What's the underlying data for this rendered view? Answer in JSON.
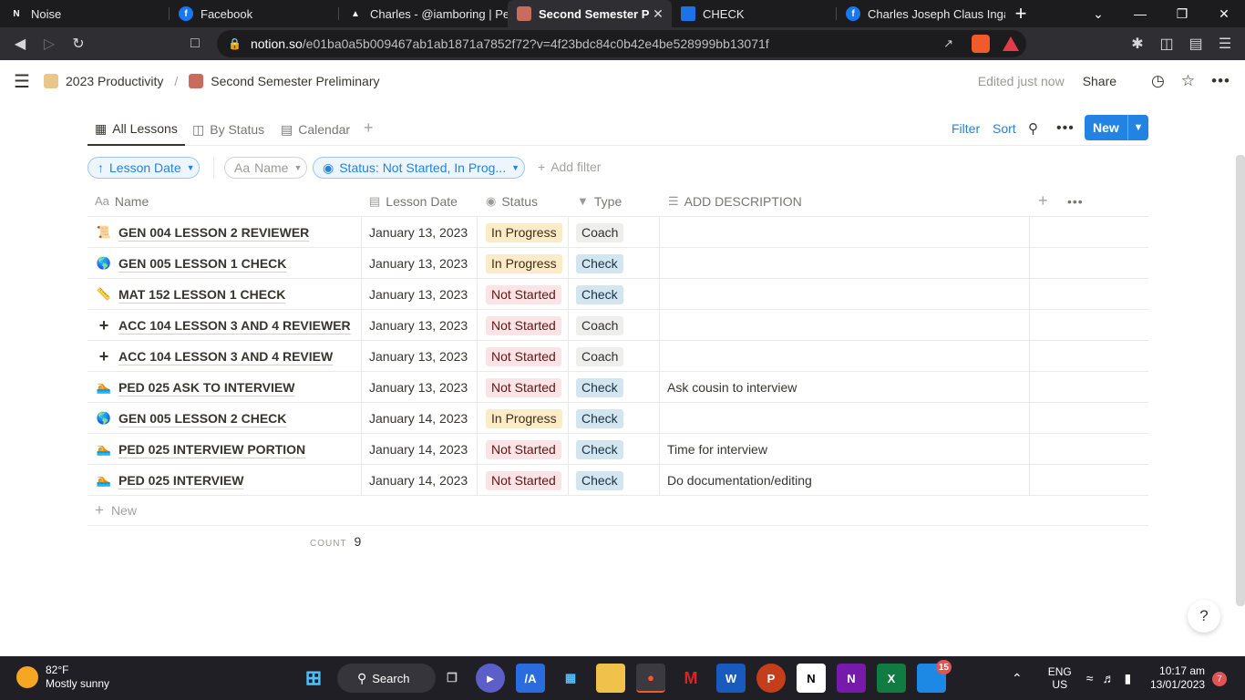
{
  "browser": {
    "tabs": [
      {
        "title": "Noise",
        "icon": "notion-icon",
        "color": "#1c1c1f"
      },
      {
        "title": "Facebook",
        "icon": "facebook-icon",
        "color": "#1877f2"
      },
      {
        "title": "Charles - @iamboring | Pea",
        "icon": "peacock-icon",
        "color": "#ffffff"
      },
      {
        "title": "Second Semester Prelim",
        "icon": "notion-page-icon",
        "color": "#c96c5e",
        "active": true
      },
      {
        "title": "CHECK",
        "icon": "classroom-icon",
        "color": "#1a73e8"
      },
      {
        "title": "Charles Joseph Claus Ingal",
        "icon": "facebook-icon",
        "color": "#1877f2"
      }
    ],
    "url_host": "notion.so",
    "url_path": "/e01ba0a5b009467ab1ab1871a7852f72?v=4f23bdc84c0b42e4be528999bb13071f",
    "brave_shield_count": "6"
  },
  "notion": {
    "breadcrumb": [
      "2023 Productivity",
      "Second Semester Preliminary"
    ],
    "edited": "Edited just now",
    "share": "Share",
    "views": [
      "All Lessons",
      "By Status",
      "Calendar"
    ],
    "toolbar": {
      "filter": "Filter",
      "sort": "Sort",
      "new": "New"
    },
    "chips": {
      "sort": "Lesson Date",
      "name": "Name",
      "status": "Status: Not Started, In Prog..."
    },
    "add_filter": "Add filter",
    "columns": [
      "Name",
      "Lesson Date",
      "Status",
      "Type",
      "ADD DESCRIPTION"
    ],
    "rows": [
      {
        "icon": "scroll-icon",
        "glyph": "📜",
        "name": "GEN 004 LESSON 2 REVIEWER",
        "date": "January 13, 2023",
        "status": "In Progress",
        "type": "Coach",
        "desc": ""
      },
      {
        "icon": "globe-icon",
        "glyph": "🌎",
        "name": "GEN 005 LESSON 1 CHECK",
        "date": "January 13, 2023",
        "status": "In Progress",
        "type": "Check",
        "desc": ""
      },
      {
        "icon": "ruler-icon",
        "glyph": "📏",
        "name": "MAT 152 LESSON 1 CHECK",
        "date": "January 13, 2023",
        "status": "Not Started",
        "type": "Check",
        "desc": ""
      },
      {
        "icon": "plus-icon",
        "glyph": "+",
        "name": "ACC 104 LESSON 3 AND 4 REVIEWER",
        "date": "January 13, 2023",
        "status": "Not Started",
        "type": "Coach",
        "desc": ""
      },
      {
        "icon": "plus-icon",
        "glyph": "+",
        "name": "ACC 104 LESSON 3 AND 4 REVIEW",
        "date": "January 13, 2023",
        "status": "Not Started",
        "type": "Coach",
        "desc": ""
      },
      {
        "icon": "swimmer-icon",
        "glyph": "🏊",
        "name": "PED 025 ASK TO INTERVIEW",
        "date": "January 13, 2023",
        "status": "Not Started",
        "type": "Check",
        "desc": "Ask cousin to interview"
      },
      {
        "icon": "globe-icon",
        "glyph": "🌎",
        "name": "GEN 005 LESSON 2 CHECK",
        "date": "January 14, 2023",
        "status": "In Progress",
        "type": "Check",
        "desc": ""
      },
      {
        "icon": "swimmer-icon",
        "glyph": "🏊",
        "name": "PED 025 INTERVIEW PORTION",
        "date": "January 14, 2023",
        "status": "Not Started",
        "type": "Check",
        "desc": "Time for interview"
      },
      {
        "icon": "swimmer-icon",
        "glyph": "🏊",
        "name": "PED 025 INTERVIEW",
        "date": "January 14, 2023",
        "status": "Not Started",
        "type": "Check",
        "desc": "Do documentation/editing"
      }
    ],
    "new_row": "New",
    "count_label": "COUNT",
    "count_value": "9",
    "colors": {
      "in_progress_bg": "#fbecc7",
      "in_progress_fg": "#402c1b",
      "not_started_bg": "#fbe3e6",
      "not_started_fg": "#5d1715",
      "check_bg": "#d3e5ef",
      "check_fg": "#183347",
      "coach_bg": "#eeeeed",
      "coach_fg": "#32302c",
      "accent": "#2383e2"
    }
  },
  "taskbar": {
    "weather_temp": "82°F",
    "weather_desc": "Mostly sunny",
    "search": "Search",
    "teams_badge": "15",
    "lang": "ENG",
    "region": "US",
    "time": "10:17 am",
    "date": "13/01/2023",
    "notifications": "7"
  }
}
